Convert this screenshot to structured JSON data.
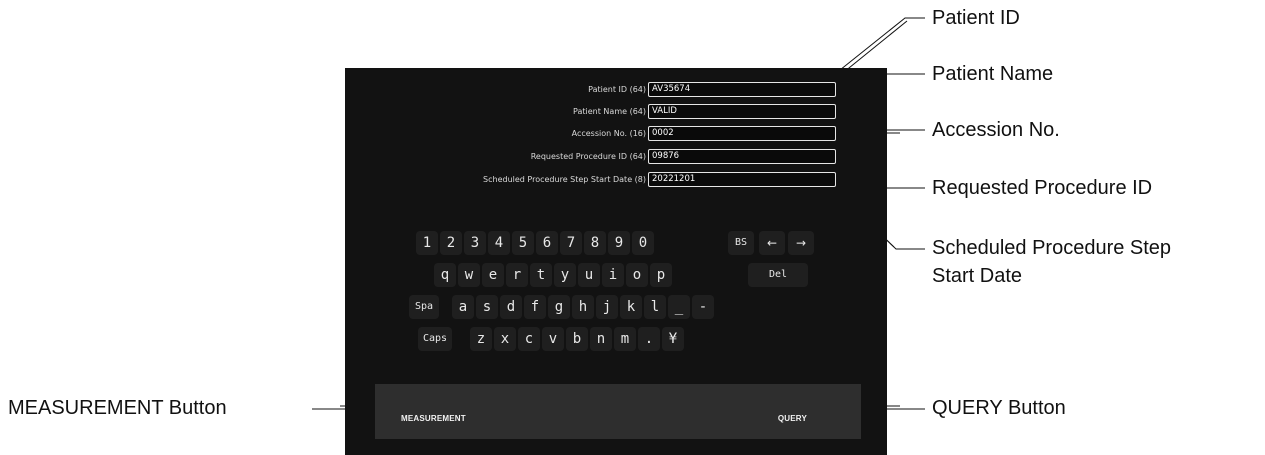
{
  "form": {
    "fields": [
      {
        "label": "Patient ID (64)",
        "value": "AV35674"
      },
      {
        "label": "Patient Name (64)",
        "value": "VALID"
      },
      {
        "label": "Accession No. (16)",
        "value": "0002"
      },
      {
        "label": "Requested Procedure ID (64)",
        "value": "09876"
      },
      {
        "label": "Scheduled Procedure Step Start Date (8)",
        "value": "20221201"
      }
    ]
  },
  "keyboard": {
    "row1": [
      "1",
      "2",
      "3",
      "4",
      "5",
      "6",
      "7",
      "8",
      "9",
      "0"
    ],
    "bs": "BS",
    "left_arrow": "←",
    "right_arrow": "→",
    "row2": [
      "q",
      "w",
      "e",
      "r",
      "t",
      "y",
      "u",
      "i",
      "o",
      "p"
    ],
    "del": "Del",
    "spa": "Spa",
    "row3": [
      "a",
      "s",
      "d",
      "f",
      "g",
      "h",
      "j",
      "k",
      "l",
      "_",
      "-"
    ],
    "caps": "Caps",
    "row4": [
      "z",
      "x",
      "c",
      "v",
      "b",
      "n",
      "m",
      ".",
      "¥"
    ]
  },
  "bottom_bar": {
    "measurement_label": "MEASUREMENT",
    "query_label": "QUERY"
  },
  "callouts": {
    "patient_id": "Patient ID",
    "patient_name": "Patient Name",
    "accession_no": "Accession No.",
    "requested_procedure_id": "Requested Procedure ID",
    "scheduled_line1": "Scheduled Procedure Step",
    "scheduled_line2": "Start Date",
    "measurement_button": "MEASUREMENT Button",
    "query_button": "QUERY Button"
  }
}
